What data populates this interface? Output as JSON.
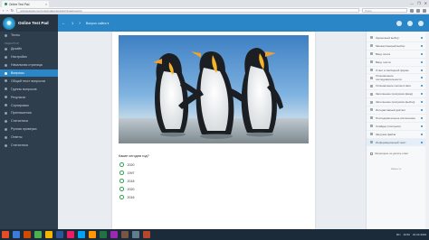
{
  "browser": {
    "tab_title": "Online Test Pad",
    "tab_close": "×",
    "window_controls": [
      "—",
      "❐",
      "✕"
    ],
    "url": "onlinetestpad.com/ru/testmaker/test/edit/visual/question",
    "search_placeholder": "Поиск"
  },
  "sidebar": {
    "brand": "Online Test Pad",
    "items_top": [
      {
        "label": "Тесты"
      }
    ],
    "section_label": "РЕДАКТОР",
    "items": [
      {
        "label": "Дизайн"
      },
      {
        "label": "Настройки"
      },
      {
        "label": "Начальная страница"
      },
      {
        "label": "Вопросы",
        "active": true
      },
      {
        "label": "Общий текст вопросов"
      },
      {
        "label": "Группы вопросов"
      },
      {
        "label": "Результат"
      },
      {
        "label": "Сортировки"
      },
      {
        "label": "Приглашения"
      },
      {
        "label": "Статистика"
      },
      {
        "label": "Ручная проверка"
      },
      {
        "label": "Ответы"
      },
      {
        "label": "Статистика"
      }
    ]
  },
  "appbar": {
    "back": "←",
    "page": "1",
    "next": "›",
    "question_label": "Вопрос сайта ▾"
  },
  "question": {
    "text": "Какие сегодня год?",
    "options": [
      "2020",
      "1997",
      "2018",
      "2020",
      "2016"
    ]
  },
  "right_panel": {
    "items": [
      {
        "label": "Одиночный выбор"
      },
      {
        "label": "Множественный выбор"
      },
      {
        "label": "Ввод числа"
      },
      {
        "label": "Ввод текста"
      },
      {
        "label": "Ответ в свободной форме"
      },
      {
        "label": "Установление последовательности"
      },
      {
        "label": "Установление соответствия"
      },
      {
        "label": "Заполнение пропусков (ввод)"
      },
      {
        "label": "Заполнение пропусков (выбор)"
      },
      {
        "label": "Интерактивный диктант"
      },
      {
        "label": "Последовательное исключение"
      },
      {
        "label": "Слайдер (ползунок)"
      },
      {
        "label": "Загрузка файла"
      },
      {
        "label": "Информационный текст",
        "selected": true
      }
    ],
    "note": "Запрещено не делать ответ",
    "save": "Закрыть"
  },
  "taskbar": {
    "colors": [
      "#e44d26",
      "#3b7dd8",
      "#d04a02",
      "#4caf50",
      "#f4b400",
      "#2b579a",
      "#e91e63",
      "#00a4ef",
      "#ff9800",
      "#217346",
      "#9c27b0",
      "#795548",
      "#607d8b",
      "#b7472a"
    ],
    "clock": "16:52",
    "date": "01.02.2019",
    "lang": "RU"
  }
}
